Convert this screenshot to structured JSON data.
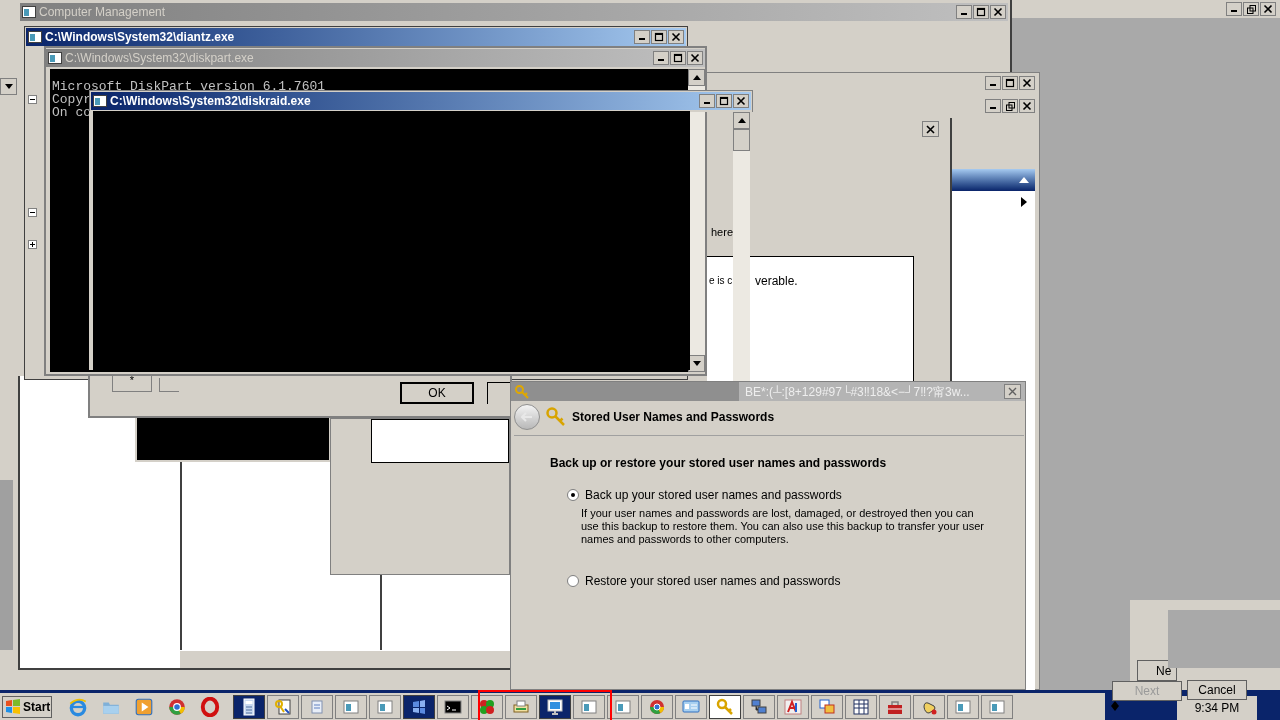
{
  "computer_management": {
    "title": "Computer Management",
    "active": false
  },
  "tree_expanders": [
    {
      "expanded": true
    },
    {
      "expanded": true
    },
    {
      "expanded": false
    }
  ],
  "diantz": {
    "title": "C:\\Windows\\System32\\diantz.exe",
    "active": true
  },
  "diskpart": {
    "title": "C:\\Windows\\System32\\diskpart.exe",
    "active": false,
    "console_lines": [
      "Microsoft DiskPart version 6.1.7601",
      "Copyr",
      "On co"
    ]
  },
  "diskraid": {
    "title": "C:\\Windows\\System32\\diskraid.exe",
    "active": true
  },
  "back_dialog": {
    "texts": [
      "here",
      "e is c",
      "verable."
    ],
    "small_button": "*",
    "ok_button": "OK"
  },
  "credential_wizard": {
    "title": "BE*:(┴:[8+129#97└#3‼18&<−┘7‼?甯3w...",
    "heading": "Stored User Names and Passwords",
    "prompt": "Back up or restore your stored user names and passwords",
    "options": [
      {
        "label": "Back up your stored user names and passwords",
        "description": "If your user names and passwords are lost, damaged, or destroyed then you can use this backup to restore them. You can also use this backup to transfer your user names and passwords to other computers.",
        "selected": true
      },
      {
        "label": "Restore your stored user names and passwords",
        "selected": false
      }
    ]
  },
  "wizard_buttons": [
    {
      "label": "Ne"
    },
    {
      "label": "Next"
    },
    {
      "label": "Cancel"
    }
  ],
  "taskbar": {
    "start": "Start",
    "clock": "9:34 PM",
    "quick_launch": [
      {
        "kind": "ie"
      },
      {
        "kind": "folder"
      },
      {
        "kind": "play"
      },
      {
        "kind": "wheel"
      },
      {
        "kind": "ring"
      }
    ],
    "tasks": [
      {
        "kind": "calc",
        "pressed": true,
        "highlighted": false
      },
      {
        "kind": "keydoc",
        "pressed": false,
        "highlighted": false
      },
      {
        "kind": "doc",
        "pressed": false,
        "highlighted": false
      },
      {
        "kind": "window",
        "pressed": false,
        "highlighted": false
      },
      {
        "kind": "window",
        "pressed": false,
        "highlighted": false
      },
      {
        "kind": "flag",
        "pressed": true,
        "highlighted": false
      },
      {
        "kind": "console",
        "pressed": false,
        "highlighted": false
      },
      {
        "kind": "puzzle",
        "pressed": false,
        "highlighted": false
      },
      {
        "kind": "printer",
        "pressed": false,
        "highlighted": false
      },
      {
        "kind": "monitor",
        "pressed": true,
        "highlighted": false
      },
      {
        "kind": "window",
        "pressed": false,
        "highlighted": false
      },
      {
        "kind": "window",
        "pressed": false,
        "highlighted": false
      },
      {
        "kind": "wheel",
        "pressed": false,
        "highlighted": false
      },
      {
        "kind": "card",
        "pressed": false,
        "highlighted": false
      },
      {
        "kind": "key",
        "pressed": false,
        "highlighted": true
      },
      {
        "kind": "computers",
        "pressed": false,
        "highlighted": false
      },
      {
        "kind": "font",
        "pressed": false,
        "highlighted": false
      },
      {
        "kind": "windows",
        "pressed": false,
        "highlighted": false
      },
      {
        "kind": "table",
        "pressed": false,
        "highlighted": false
      },
      {
        "kind": "toolbox",
        "pressed": false,
        "highlighted": false
      },
      {
        "kind": "hand",
        "pressed": false,
        "highlighted": false
      },
      {
        "kind": "window",
        "pressed": false,
        "highlighted": false
      },
      {
        "kind": "window",
        "pressed": false,
        "highlighted": false
      }
    ]
  }
}
